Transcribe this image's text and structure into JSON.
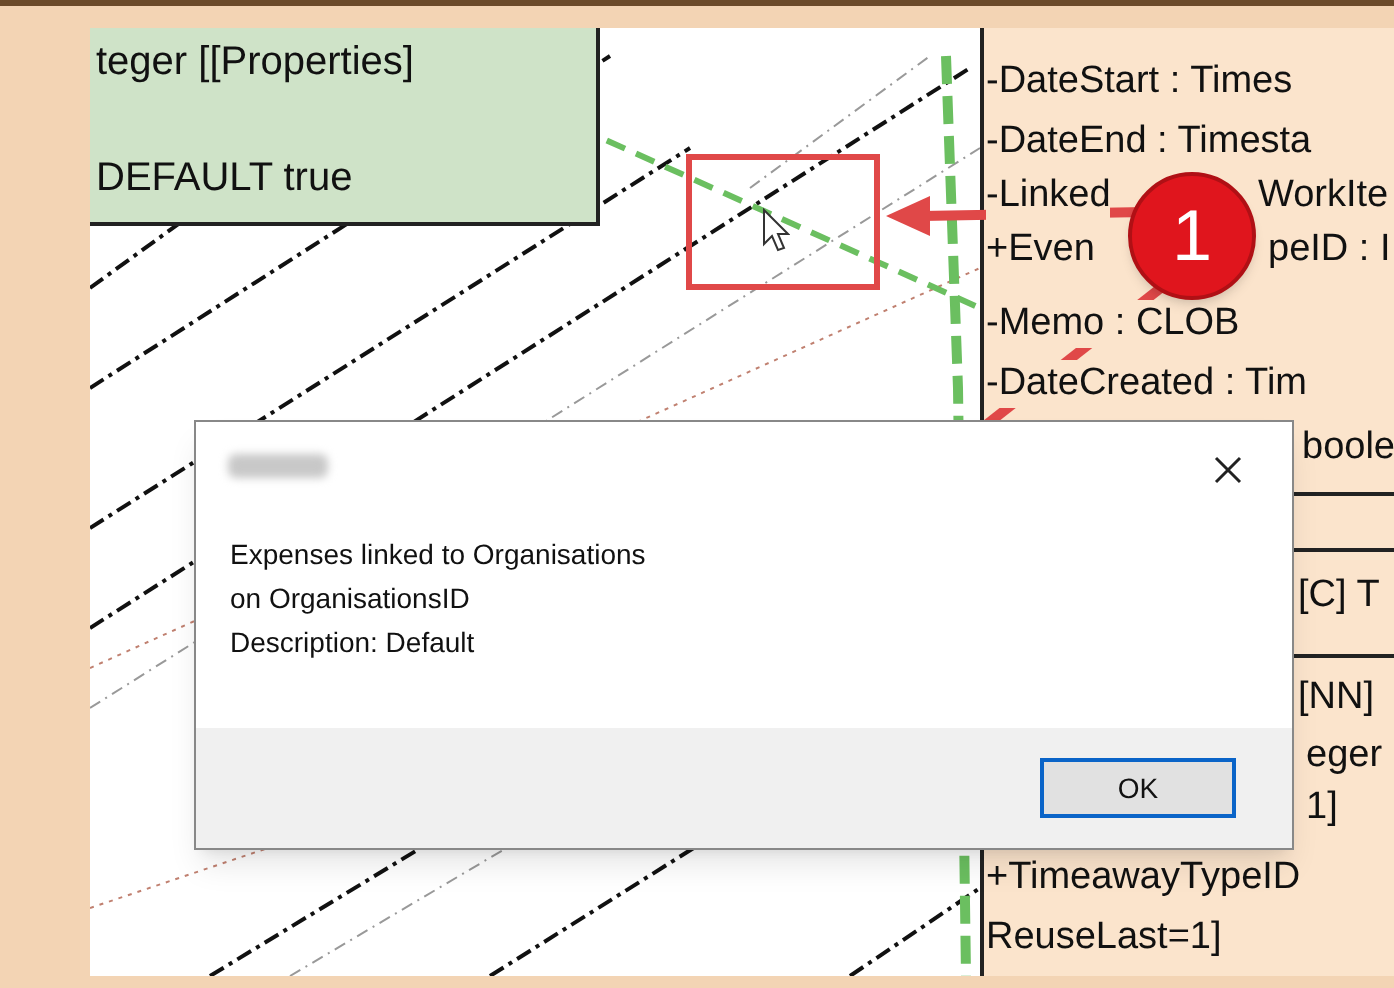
{
  "left_node": {
    "lines": [
      "teger [[Properties]",
      "DEFAULT true"
    ]
  },
  "right_node": {
    "rows": [
      {
        "parts": [
          "-DateStart : Times"
        ]
      },
      {
        "parts": [
          "-DateEnd : Timesta"
        ]
      },
      {
        "parts": [
          "-Linked",
          "WorkIte"
        ]
      },
      {
        "parts": [
          "+Even",
          "peID : I"
        ]
      },
      {
        "parts": [
          "-Memo : CLOB"
        ]
      },
      {
        "parts": [
          "-DateCreated : Tim"
        ]
      },
      {
        "parts": [
          "boole"
        ]
      },
      {
        "parts": [
          "[C] T"
        ]
      },
      {
        "parts": [
          "[NN]"
        ]
      },
      {
        "parts": [
          "eger"
        ]
      },
      {
        "parts": [
          "1]"
        ]
      },
      {
        "parts": [
          "+TimeawayTypeID"
        ]
      },
      {
        "parts": [
          "ReuseLast=1]"
        ]
      }
    ]
  },
  "dialog": {
    "message_lines": [
      "Expenses linked to Organisations",
      "on OrganisationsID",
      "Description: Default"
    ],
    "button": "OK"
  },
  "annotation": {
    "badge": "1"
  }
}
